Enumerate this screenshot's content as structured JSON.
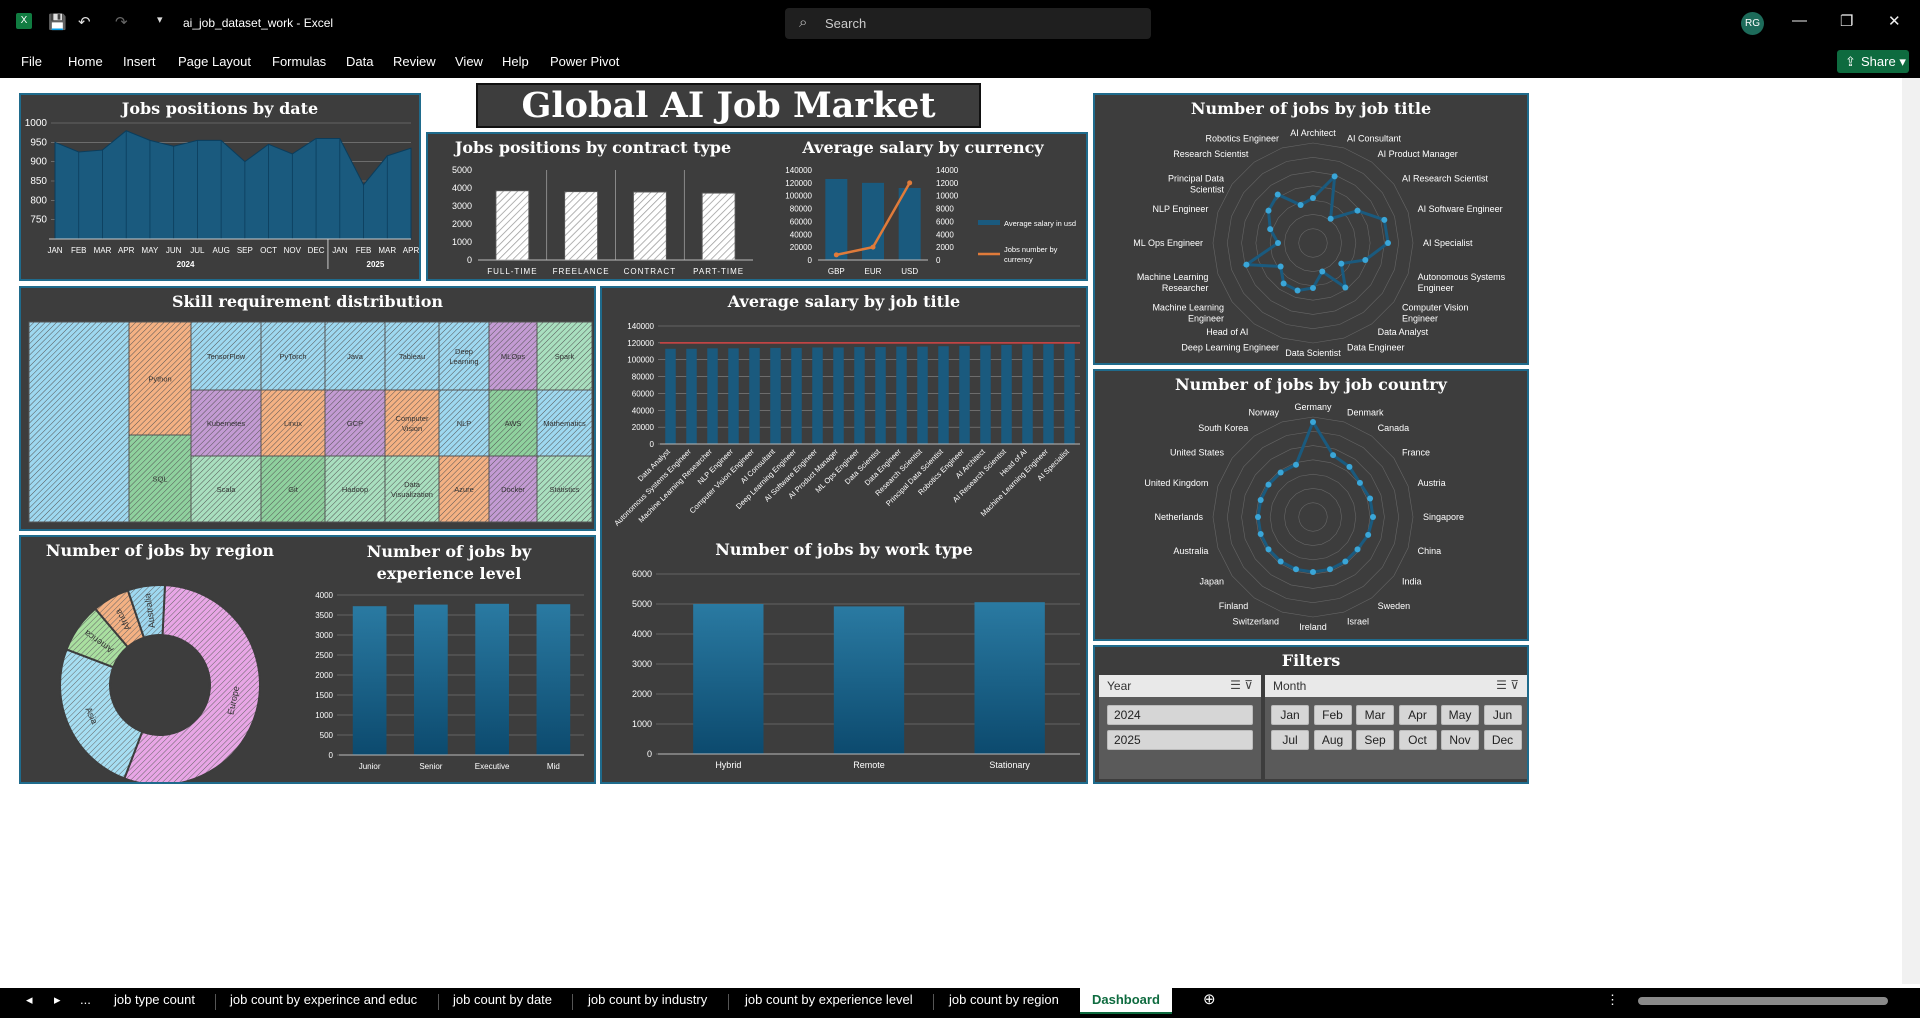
{
  "app": {
    "title": "ai_job_dataset_work  -  Excel",
    "search_placeholder": "Search",
    "avatar": "RG",
    "share_label": "Share"
  },
  "menu": [
    "File",
    "Home",
    "Insert",
    "Page Layout",
    "Formulas",
    "Data",
    "Review",
    "View",
    "Help",
    "Power Pivot"
  ],
  "dashboard": {
    "title": "Global AI Job Market",
    "panels": {
      "date": "Jobs positions by date",
      "contract": "Jobs positions by contract type",
      "currency": "Average salary by currency",
      "jobtitle_radar": "Number of jobs by job title",
      "skills": "Skill requirement distribution",
      "salary_title": "Average salary by job title",
      "country": "Number of jobs by job country",
      "region": "Number of jobs by region",
      "experience": "Number of jobs by experience level",
      "worktype": "Number of jobs by work type",
      "filters": "Filters"
    }
  },
  "chart_data": [
    {
      "type": "area",
      "id": "date",
      "categories": [
        "JAN",
        "FEB",
        "MAR",
        "APR",
        "MAY",
        "JUN",
        "JUL",
        "AUG",
        "SEP",
        "OCT",
        "NOV",
        "DEC",
        "JAN",
        "FEB",
        "MAR",
        "APR"
      ],
      "groups": [
        "2024",
        "2025"
      ],
      "values": [
        950,
        925,
        930,
        980,
        955,
        940,
        955,
        955,
        900,
        945,
        920,
        960,
        960,
        840,
        915,
        935
      ],
      "yticks": [
        750,
        800,
        850,
        900,
        950,
        1000
      ],
      "ylim": [
        700,
        1000
      ]
    },
    {
      "type": "bar",
      "id": "contract",
      "categories": [
        "FULL-TIME",
        "FREELANCE",
        "CONTRACT",
        "PART-TIME"
      ],
      "values": [
        3850,
        3800,
        3780,
        3720
      ],
      "yticks": [
        0,
        1000,
        2000,
        3000,
        4000,
        5000
      ],
      "ylim": [
        0,
        5000
      ]
    },
    {
      "type": "bar",
      "id": "currency",
      "categories": [
        "GBP",
        "EUR",
        "USD"
      ],
      "series": [
        {
          "name": "Average salary in usd",
          "values": [
            126000,
            120000,
            112000
          ]
        },
        {
          "name": "Jobs number by currency",
          "values": [
            800,
            2000,
            12000
          ]
        }
      ],
      "yticks": [
        0,
        20000,
        40000,
        60000,
        80000,
        100000,
        120000,
        140000
      ],
      "y2ticks": [
        0,
        2000,
        4000,
        6000,
        8000,
        10000,
        12000,
        14000
      ],
      "ylim": [
        0,
        140000
      ],
      "y2lim": [
        0,
        14000
      ]
    },
    {
      "type": "radar",
      "id": "jobtitle",
      "categories": [
        "AI Architect",
        "AI Consultant",
        "AI Product Manager",
        "AI Research Scientist",
        "AI Software Engineer",
        "AI Specialist",
        "Autonomous Systems Engineer",
        "Computer Vision Engineer",
        "Data Analyst",
        "Data Engineer",
        "Data Scientist",
        "Deep Learning Engineer",
        "Head of AI",
        "Machine Learning Engineer",
        "Machine Learning Researcher",
        "ML Ops Engineer",
        "NLP Engineer",
        "Principal Data Scientist",
        "Research Scientist",
        "Robotics Engineer"
      ],
      "values": [
        0.45,
        0.7,
        0.3,
        0.55,
        0.75,
        0.75,
        0.55,
        0.35,
        0.55,
        0.3,
        0.45,
        0.5,
        0.5,
        0.4,
        0.7,
        0.35,
        0.45,
        0.55,
        0.6,
        0.4
      ]
    },
    {
      "type": "heatmap",
      "id": "skills",
      "items": [
        "",
        "Python",
        "SQL",
        "TensorFlow",
        "Kubernetes",
        "Scala",
        "PyTorch",
        "Linux",
        "Git",
        "Java",
        "GCP",
        "Hadoop",
        "Tableau",
        "Computer Vision",
        "Data Visualization",
        "Deep Learning",
        "NLP",
        "Azure",
        "MLOps",
        "AWS",
        "Docker",
        "Spark",
        "Mathematics",
        "Statistics"
      ]
    },
    {
      "type": "bar",
      "id": "salary_title",
      "categories": [
        "Data Analyst",
        "Autonomous Systems Engineer",
        "Machine Learning Researcher",
        "NLP Engineer",
        "Computer Vision Engineer",
        "AI Consultant",
        "Deep Learning Engineer",
        "AI Software Engineer",
        "AI Product Manager",
        "ML Ops Engineer",
        "Data Scientist",
        "Data Engineer",
        "Research Scientist",
        "Principal Data Scientist",
        "Robotics Engineer",
        "AI Architect",
        "AI Research Scientist",
        "Head of AI",
        "Machine Learning Engineer",
        "AI Specialist"
      ],
      "values": [
        113000,
        113000,
        113500,
        113500,
        114000,
        114000,
        114000,
        114500,
        114500,
        115000,
        115000,
        115500,
        115500,
        116000,
        116500,
        117000,
        117500,
        118000,
        118500,
        119000
      ],
      "reference": 120000,
      "yticks": [
        0,
        20000,
        40000,
        60000,
        80000,
        100000,
        120000,
        140000
      ],
      "ylim": [
        0,
        140000
      ]
    },
    {
      "type": "radar",
      "id": "country",
      "categories": [
        "Germany",
        "Denmark",
        "Canada",
        "France",
        "Austria",
        "Singapore",
        "China",
        "India",
        "Sweden",
        "Israel",
        "Ireland",
        "Switzerland",
        "Finland",
        "Japan",
        "Australia",
        "Netherlands",
        "United Kingdom",
        "United States",
        "South Korea",
        "Norway"
      ],
      "values": [
        0.95,
        0.65,
        0.62,
        0.58,
        0.6,
        0.6,
        0.58,
        0.55,
        0.55,
        0.55,
        0.55,
        0.55,
        0.55,
        0.55,
        0.55,
        0.55,
        0.55,
        0.55,
        0.55,
        0.55
      ]
    },
    {
      "type": "pie",
      "id": "region",
      "categories": [
        "Europe",
        "Asia",
        "America",
        "Africa",
        "Australia"
      ],
      "values": [
        55,
        25,
        8,
        6,
        6
      ]
    },
    {
      "type": "bar",
      "id": "experience",
      "categories": [
        "Junior",
        "Senior",
        "Executive",
        "Mid"
      ],
      "values": [
        3720,
        3760,
        3780,
        3770
      ],
      "yticks": [
        0,
        500,
        1000,
        1500,
        2000,
        2500,
        3000,
        3500,
        4000
      ],
      "ylim": [
        0,
        4000
      ]
    },
    {
      "type": "bar",
      "id": "worktype",
      "categories": [
        "Hybrid",
        "Remote",
        "Stationary"
      ],
      "values": [
        5000,
        4920,
        5060
      ],
      "yticks": [
        0,
        1000,
        2000,
        3000,
        4000,
        5000,
        6000
      ],
      "ylim": [
        0,
        6000
      ]
    }
  ],
  "filters": {
    "year_label": "Year",
    "month_label": "Month",
    "years": [
      "2024",
      "2025"
    ],
    "months": [
      "Jan",
      "Feb",
      "Mar",
      "Apr",
      "May",
      "Jun",
      "Jul",
      "Aug",
      "Sep",
      "Oct",
      "Nov",
      "Dec"
    ]
  },
  "sheets": [
    "...",
    "job type count",
    "job count by experince and educ",
    "job count by date",
    "job count by industry",
    "job count by experience level",
    "job count by region",
    "Dashboard"
  ],
  "active_sheet": "Dashboard",
  "colors": {
    "panel": "#3d3d3d",
    "accent": "#1a5a7e",
    "border": "#1f6b8c",
    "line": "#e07b3a",
    "ref": "#d64545"
  }
}
